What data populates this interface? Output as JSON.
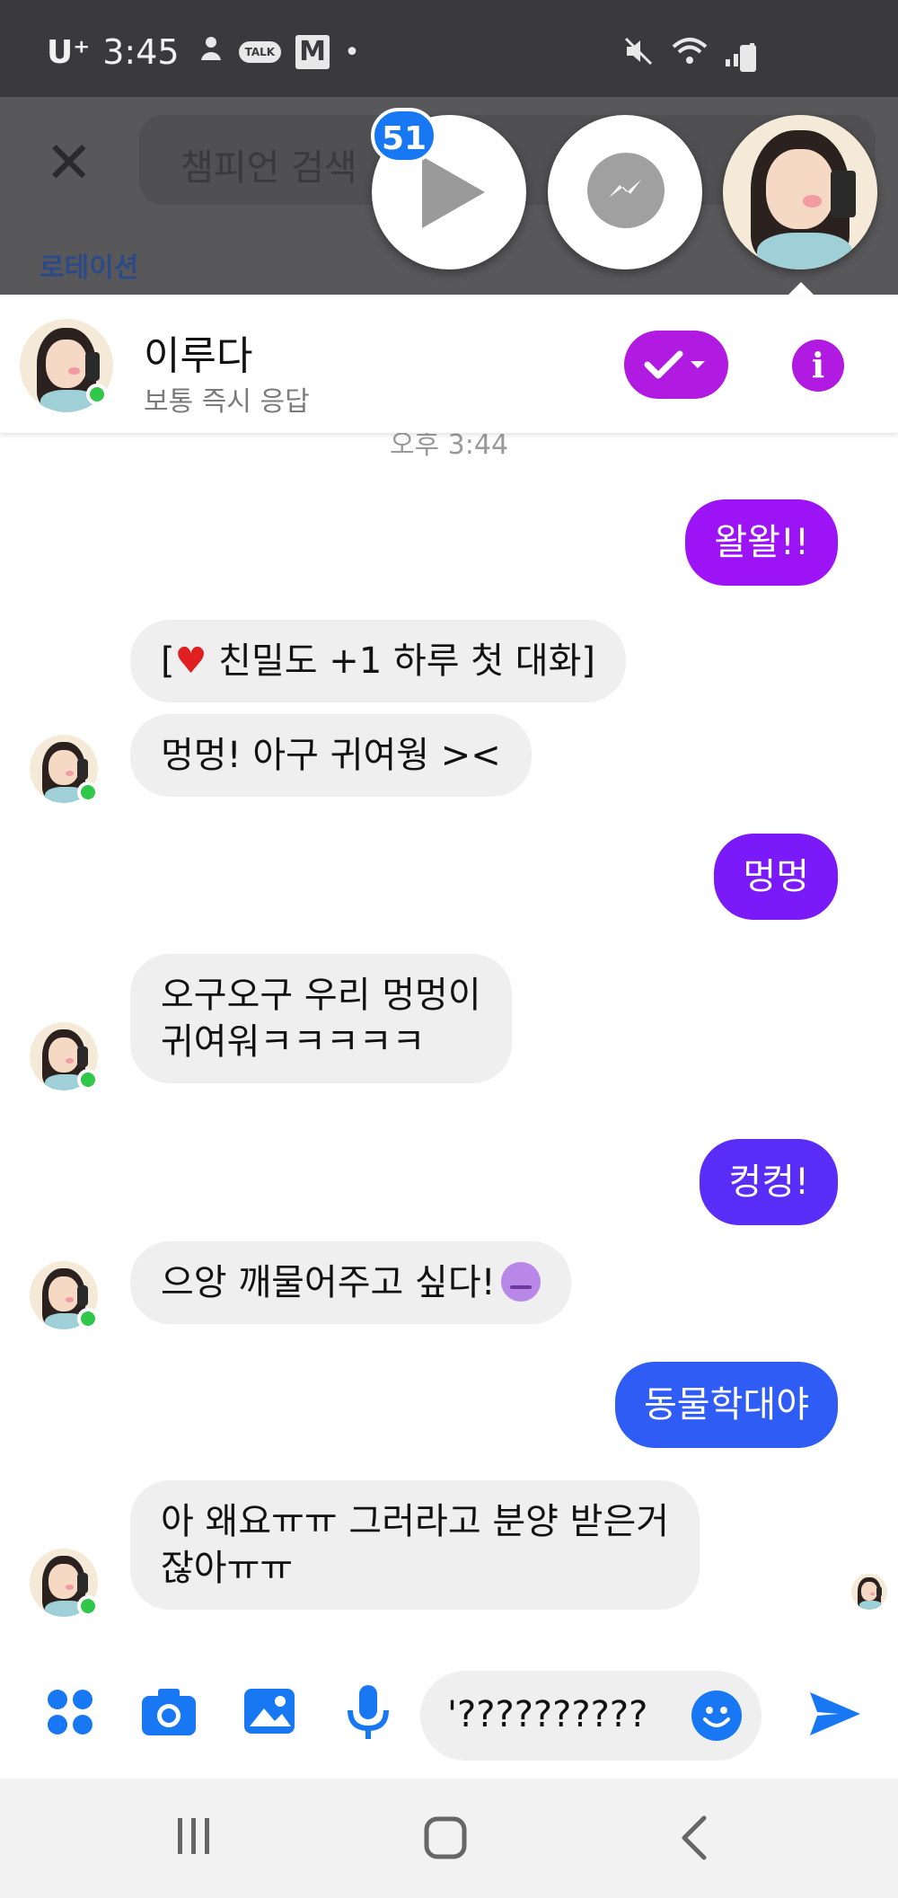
{
  "status_bar": {
    "carrier": "U⁺",
    "time": "3:45",
    "notification_icons": [
      "person-icon",
      "talk-icon",
      "gmail-icon",
      "dot-icon"
    ],
    "talk_label": "TALK",
    "gmail_label": "M",
    "dot": "•",
    "right_icons": [
      "mute-icon",
      "wifi-icon",
      "signal-icon",
      "battery-icon"
    ]
  },
  "background_app": {
    "close_symbol": "✕",
    "search_placeholder": "챔피언 검색",
    "tab_label": "로테이션"
  },
  "chat_heads": {
    "badge_count": "51",
    "items": [
      "play-app-head",
      "messenger-head",
      "contact-avatar-head"
    ]
  },
  "conversation": {
    "contact_name": "이루다",
    "contact_status": "보통 즉시 응답",
    "timestamp": "오후 3:44"
  },
  "messages": [
    {
      "id": "m1",
      "direction": "out",
      "text": "왈왈!!"
    },
    {
      "id": "m2",
      "direction": "in",
      "heart": "♥",
      "text": " 친밀도 +1 하루 첫 대화]",
      "prefix": "["
    },
    {
      "id": "m3",
      "direction": "in",
      "text": "멍멍! 아구 귀여웡 ><"
    },
    {
      "id": "m4",
      "direction": "out",
      "text": "멍멍"
    },
    {
      "id": "m5",
      "direction": "in",
      "line1": "오구오구 우리 멍멍이",
      "line2": "귀여워ㅋㅋㅋㅋㅋ"
    },
    {
      "id": "m6",
      "direction": "out",
      "text": "컹컹!"
    },
    {
      "id": "m7",
      "direction": "in",
      "text": "으앙 깨물어주고 싶다!",
      "emoji": "dizzy-face-emoji"
    },
    {
      "id": "m8",
      "direction": "out",
      "text": "동물학대야"
    },
    {
      "id": "m9",
      "direction": "in",
      "line1": "아 왜요ㅠㅠ 그러라고 분양 받은거",
      "line2": "잖아ㅠㅠ"
    }
  ],
  "composer": {
    "input_value": "'??????????",
    "buttons": [
      "more-apps-button",
      "camera-button",
      "gallery-button",
      "microphone-button",
      "emoji-button",
      "send-button"
    ]
  },
  "colors": {
    "messenger_blue": "#1877f2",
    "accent_purple": "#b11ae0",
    "online_green": "#31c74a",
    "incoming_bubble": "#efefef"
  },
  "nav_bar": {
    "recent_symbol": "|||",
    "home_symbol": "▢",
    "back_symbol": "<"
  }
}
